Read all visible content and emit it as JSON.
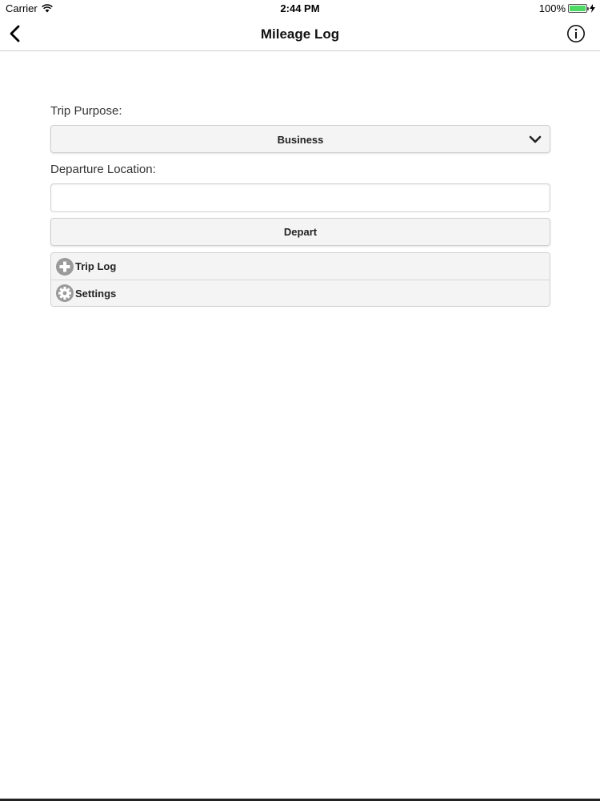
{
  "status_bar": {
    "carrier": "Carrier",
    "time": "2:44 PM",
    "battery": "100%",
    "battery_color": "#4cd964"
  },
  "nav": {
    "title": "Mileage Log",
    "back_icon": "chevron-left-icon",
    "info_icon": "info-icon"
  },
  "form": {
    "trip_purpose_label": "Trip Purpose:",
    "trip_purpose_value": "Business",
    "departure_label": "Departure Location:",
    "departure_value": "",
    "departure_placeholder": "",
    "depart_button": "Depart"
  },
  "sections": [
    {
      "label": "Trip Log",
      "icon": "plus-icon"
    },
    {
      "label": "Settings",
      "icon": "gear-icon"
    }
  ]
}
